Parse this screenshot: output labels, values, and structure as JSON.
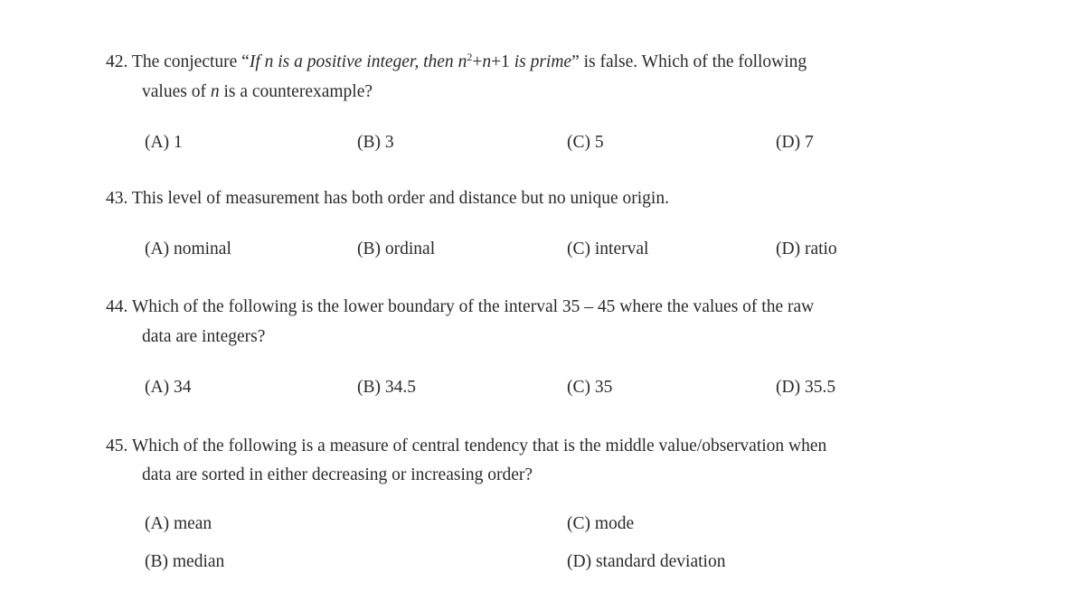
{
  "questions": [
    {
      "number": "42.",
      "text_parts": {
        "a": "The conjecture “",
        "b": "If ",
        "n1": "n",
        "c": " is a positive integer, then ",
        "n2": "n",
        "exp": "2",
        "d": "+",
        "n3": "n",
        "e": "+1",
        "f": " is prime",
        "g": "” is false. Which of the following",
        "line2_a": "values of ",
        "line2_n": "n",
        "line2_b": " is a counterexample?"
      },
      "options": [
        {
          "label": "(A)",
          "value": "1"
        },
        {
          "label": "(B)",
          "value": "3"
        },
        {
          "label": "(C)",
          "value": "5"
        },
        {
          "label": "(D)",
          "value": "7"
        }
      ]
    },
    {
      "number": "43.",
      "lines": [
        "This level of measurement has both order and distance but no unique origin."
      ],
      "options": [
        {
          "label": "(A)",
          "value": "nominal"
        },
        {
          "label": "(B)",
          "value": "ordinal"
        },
        {
          "label": "(C)",
          "value": "interval"
        },
        {
          "label": "(D)",
          "value": "ratio"
        }
      ]
    },
    {
      "number": "44.",
      "lines": [
        "Which of the following is the lower boundary of the interval 35 – 45 where the values of the raw",
        "data are integers?"
      ],
      "options": [
        {
          "label": "(A)",
          "value": "34"
        },
        {
          "label": "(B)",
          "value": "34.5"
        },
        {
          "label": "(C)",
          "value": "35"
        },
        {
          "label": "(D)",
          "value": "35.5"
        }
      ]
    },
    {
      "number": "45.",
      "lines": [
        "Which of the following is a measure of central tendency that is the middle value/observation when",
        "data are sorted in either decreasing or increasing order?"
      ],
      "options": [
        {
          "label": "(A)",
          "value": "mean"
        },
        {
          "label": "(B)",
          "value": "median"
        },
        {
          "label": "(C)",
          "value": "mode"
        },
        {
          "label": "(D)",
          "value": "standard deviation"
        }
      ]
    }
  ]
}
